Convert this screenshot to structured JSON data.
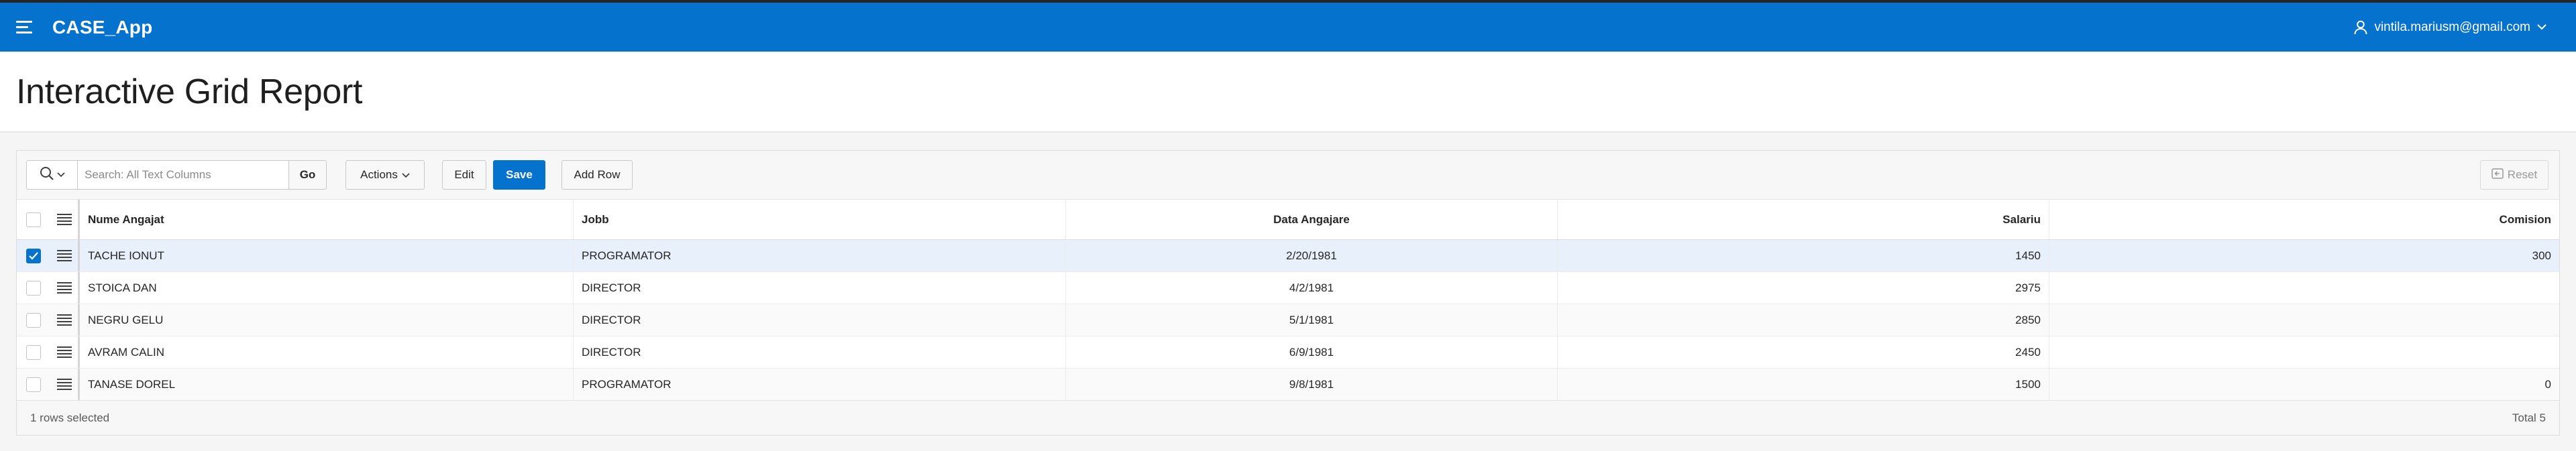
{
  "header": {
    "app_title": "CASE_App",
    "user": "vintila.mariusm@gmail.com"
  },
  "page": {
    "title": "Interactive Grid Report"
  },
  "toolbar": {
    "search_placeholder": "Search: All Text Columns",
    "go_label": "Go",
    "actions_label": "Actions",
    "edit_label": "Edit",
    "save_label": "Save",
    "add_row_label": "Add Row",
    "reset_label": "Reset"
  },
  "grid": {
    "columns": [
      "Nume Angajat",
      "Jobb",
      "Data Angajare",
      "Salariu",
      "Comision"
    ],
    "rows": [
      {
        "nume": "TACHE IONUT",
        "jobb": "PROGRAMATOR",
        "data": "2/20/1981",
        "salariu": "1450",
        "comision": "300",
        "selected": true
      },
      {
        "nume": "STOICA DAN",
        "jobb": "DIRECTOR",
        "data": "4/2/1981",
        "salariu": "2975",
        "comision": "",
        "selected": false
      },
      {
        "nume": "NEGRU GELU",
        "jobb": "DIRECTOR",
        "data": "5/1/1981",
        "salariu": "2850",
        "comision": "",
        "selected": false
      },
      {
        "nume": "AVRAM CALIN",
        "jobb": "DIRECTOR",
        "data": "6/9/1981",
        "salariu": "2450",
        "comision": "",
        "selected": false
      },
      {
        "nume": "TANASE DOREL",
        "jobb": "PROGRAMATOR",
        "data": "9/8/1981",
        "salariu": "1500",
        "comision": "0",
        "selected": false
      }
    ]
  },
  "footer": {
    "selection_status": "1 rows selected",
    "total": "Total 5"
  },
  "colors": {
    "brand": "#0572ce",
    "selected_row": "#e8f1fb"
  }
}
